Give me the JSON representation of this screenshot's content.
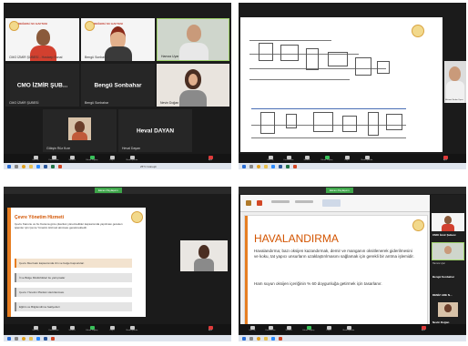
{
  "q1": {
    "tiles": [
      {
        "brand": "DEĞERLİ SU HAFTASI",
        "name": "CMO İZMİR ŞUBESİ - Hostcep Sanal"
      },
      {
        "brand": "DEĞERLİ SU HAFTASI",
        "name": "Bengü Sonbahar"
      },
      {
        "name": "Hamza Uyar"
      },
      {
        "label": "CMO İZMİR ŞUB...",
        "name": "CMO İZMİR ŞUBESİ"
      },
      {
        "label": "Bengü Sonbahar",
        "name": "Bengü Sonbahar"
      },
      {
        "name": "Nevin Doğan"
      },
      {
        "name": "Gökşin Rüz Kıze"
      },
      {
        "label": "Heval DAYAN",
        "name": "Heval Dayan"
      }
    ],
    "controls": [
      "Sesi aç",
      "Katılımcılar",
      "Sohbet",
      "Ekran Paylaş",
      "Kayıt",
      "Reaksiyonlar",
      "Ayrıl"
    ]
  },
  "q2": {
    "speaker_name": "Mehmet Serdar Yapıcı",
    "controls": [
      "Sesi aç",
      "Katılımcılar",
      "Sohbet",
      "Ekran Paylaş",
      "Kayıt",
      "Reaksiyonlar",
      "Ayrıl"
    ]
  },
  "q3": {
    "top_bar": "Ekran Paylaşımı",
    "slide_title": "Çevre Yönetim Hizmeti",
    "slide_body": "Çevre Kanunu ve bu Kanuna göre çıkarılan yönetmelikler kapsamında yapılması gereken işlemler için Çevre Yönetim Hizmeti alınması gerekmektedir.",
    "items": [
      "Çevre Mevzuatı kapsamında izin ve belge başvuruları",
      "İl ve Bölge Müdürlükleri ile yazışmalar",
      "Çevre Yönetim Planları Hazırlanması",
      "Eğitim ve Bilgilendirme faaliyetleri"
    ],
    "side_name": "Hamza Uyar",
    "controls": [
      "Sesi aç",
      "Katılımcılar",
      "Sohbet",
      "Ekran Paylaş",
      "Kayıt",
      "Reaksiyonlar",
      "Ayrıl"
    ]
  },
  "q4": {
    "top_bar": "Ekran Paylaşımı",
    "slide_title": "HAVALANDIRMA",
    "p1": "Havalandırma; bazı oksijen kazandırmak, demir ve manganın oksitlenerek giderilmesini ve koku, tat yapıcı unsurların uzaklaştırılmasını sağlamak için gerekli bir arıtma işlemidir.",
    "p2": "Ham suyun oksijen içeriğinin % 60 doygunluğa getirmek için tasarlanır.",
    "participants": [
      {
        "name": "CMO İzmir Şubesi"
      },
      {
        "name": "Hamza Uyar"
      },
      {
        "name": "Bengü Sonbahar"
      },
      {
        "name": "DENİZ ADE N..."
      },
      {
        "name": "Gökşin Rüz Kıze"
      },
      {
        "name": "Nevin Doğan"
      }
    ],
    "controls": [
      "Sesi aç",
      "Katılımcılar",
      "Sohbet",
      "Ekran Paylaş",
      "Kayıt",
      "Reaksiyonlar",
      "Ayrıl"
    ]
  },
  "taskbar": {
    "temp": "25°C  Güneşli"
  }
}
